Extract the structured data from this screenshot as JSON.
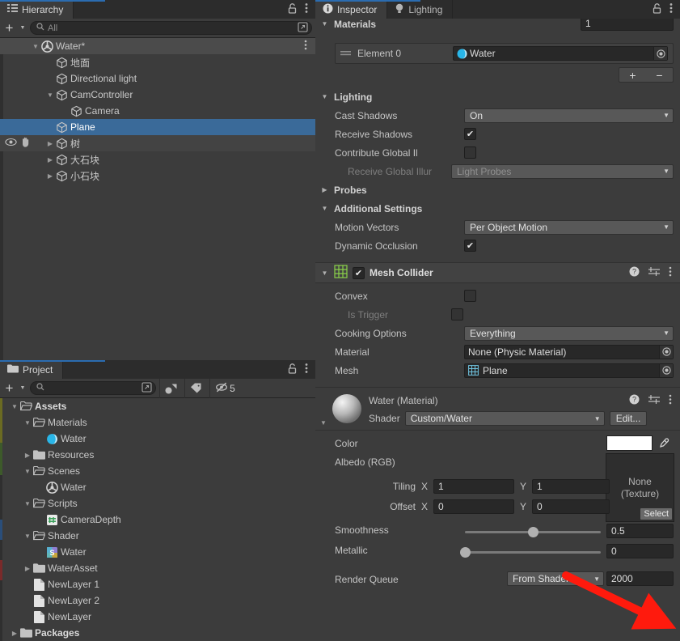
{
  "hierarchy": {
    "tab_label": "Hierarchy",
    "tab_icon": "hierarchy-icon",
    "lock_icon": "lock-icon",
    "menu_icon": "kebab-menu-icon",
    "add_label": "+",
    "search_placeholder": "All",
    "rows": [
      {
        "label": "Water*",
        "indent": 0,
        "twisty": "down",
        "icon": "unity-prefab-icon",
        "selected": false,
        "root": true,
        "menu": true
      },
      {
        "label": "地面",
        "indent": 1,
        "twisty": "none",
        "icon": "gameobject-cube-icon",
        "selected": false
      },
      {
        "label": "Directional light",
        "indent": 1,
        "twisty": "none",
        "icon": "gameobject-cube-icon",
        "selected": false
      },
      {
        "label": "CamController",
        "indent": 1,
        "twisty": "down",
        "icon": "gameobject-cube-icon",
        "selected": false
      },
      {
        "label": "Camera",
        "indent": 2,
        "twisty": "none",
        "icon": "gameobject-cube-icon",
        "selected": false
      },
      {
        "label": "Plane",
        "indent": 1,
        "twisty": "none",
        "icon": "gameobject-cube-icon",
        "selected": true
      },
      {
        "label": "树",
        "indent": 1,
        "twisty": "right",
        "icon": "gameobject-cube-icon",
        "selected": false,
        "hover": true,
        "visibility": true
      },
      {
        "label": "大石块",
        "indent": 1,
        "twisty": "right",
        "icon": "gameobject-cube-icon",
        "selected": false
      },
      {
        "label": "小石块",
        "indent": 1,
        "twisty": "right",
        "icon": "gameobject-cube-icon",
        "selected": false
      }
    ]
  },
  "project": {
    "tab_label": "Project",
    "tab_icon": "folder-icon",
    "lock_icon": "lock-icon",
    "menu_icon": "kebab-menu-icon",
    "add_label": "+",
    "search_placeholder": "",
    "filter_type_icon": "shape-filter-icon",
    "filter_label_icon": "tag-filter-icon",
    "hidden_icon": "hidden-packages-icon",
    "hidden_count": "5",
    "rows": [
      {
        "label": "Assets",
        "indent": 0,
        "twisty": "down",
        "icon": "folder-open-icon",
        "bold": true
      },
      {
        "label": "Materials",
        "indent": 1,
        "twisty": "down",
        "icon": "folder-open-icon"
      },
      {
        "label": "Water",
        "indent": 2,
        "twisty": "none",
        "icon": "material-sphere-icon"
      },
      {
        "label": "Resources",
        "indent": 1,
        "twisty": "right",
        "icon": "folder-icon"
      },
      {
        "label": "Scenes",
        "indent": 1,
        "twisty": "down",
        "icon": "folder-open-icon"
      },
      {
        "label": "Water",
        "indent": 2,
        "twisty": "none",
        "icon": "unity-scene-icon"
      },
      {
        "label": "Scripts",
        "indent": 1,
        "twisty": "down",
        "icon": "folder-open-icon"
      },
      {
        "label": "CameraDepth",
        "indent": 2,
        "twisty": "none",
        "icon": "csharp-script-icon"
      },
      {
        "label": "Shader",
        "indent": 1,
        "twisty": "down",
        "icon": "folder-open-icon"
      },
      {
        "label": "Water",
        "indent": 2,
        "twisty": "none",
        "icon": "shader-icon"
      },
      {
        "label": "WaterAsset",
        "indent": 1,
        "twisty": "right",
        "icon": "folder-icon"
      },
      {
        "label": "NewLayer 1",
        "indent": 1,
        "twisty": "none",
        "icon": "file-icon"
      },
      {
        "label": "NewLayer 2",
        "indent": 1,
        "twisty": "none",
        "icon": "file-icon"
      },
      {
        "label": "NewLayer",
        "indent": 1,
        "twisty": "none",
        "icon": "file-icon"
      },
      {
        "label": "Packages",
        "indent": 0,
        "twisty": "right",
        "icon": "folder-icon",
        "bold": true
      }
    ]
  },
  "inspector": {
    "tabs": [
      {
        "label": "Inspector",
        "icon": "info-icon",
        "active": true
      },
      {
        "label": "Lighting",
        "icon": "light-bulb-icon",
        "active": false
      }
    ],
    "lock_icon": "lock-icon",
    "menu_icon": "kebab-menu-icon",
    "materials": {
      "header": "Materials",
      "size_value": "1",
      "element_label": "Element 0",
      "element_value": "Water",
      "element_icon": "material-sphere-icon",
      "picker_icon": "object-picker-icon",
      "drag_handle_icon": "drag-handle-icon",
      "add_label": "+",
      "remove_label": "−"
    },
    "lighting": {
      "header": "Lighting",
      "rows": [
        {
          "label": "Cast Shadows",
          "kind": "dropdown",
          "value": "On"
        },
        {
          "label": "Receive Shadows",
          "kind": "checkbox",
          "checked": true
        },
        {
          "label": "Contribute Global Il",
          "kind": "checkbox",
          "checked": false
        },
        {
          "label": "Receive Global Illur",
          "kind": "dropdown",
          "value": "Light Probes",
          "disabled": true
        }
      ]
    },
    "probes": {
      "header": "Probes"
    },
    "additional_settings": {
      "header": "Additional Settings",
      "rows": [
        {
          "label": "Motion Vectors",
          "kind": "dropdown",
          "value": "Per Object Motion"
        },
        {
          "label": "Dynamic Occlusion",
          "kind": "checkbox",
          "checked": true
        }
      ]
    },
    "mesh_collider": {
      "title": "Mesh Collider",
      "icon": "mesh-collider-icon",
      "enabled": true,
      "help_icon": "help-icon",
      "preset_icon": "preset-icon",
      "menu_icon": "kebab-menu-icon",
      "rows": [
        {
          "label": "Convex",
          "kind": "checkbox",
          "checked": false
        },
        {
          "label": "Is Trigger",
          "kind": "checkbox",
          "checked": false,
          "disabled": true
        },
        {
          "label": "Cooking Options",
          "kind": "dropdown",
          "value": "Everything"
        },
        {
          "label": "Material",
          "kind": "object",
          "value": "None (Physic Material)",
          "icon": ""
        },
        {
          "label": "Mesh",
          "kind": "object",
          "value": "Plane",
          "icon": "mesh-icon"
        }
      ]
    },
    "material_preview": {
      "title": "Water (Material)",
      "preview_icon": "material-sphere-preview",
      "help_icon": "help-icon",
      "preset_icon": "preset-icon",
      "menu_icon": "kebab-menu-icon",
      "shader_label": "Shader",
      "shader_value": "Custom/Water",
      "edit_label": "Edit...",
      "expand_icon": "foldout-down-icon"
    },
    "material_props": {
      "color_label": "Color",
      "color_value_hex": "#ffffff",
      "eyedropper_icon": "eyedropper-icon",
      "albedo_label": "Albedo (RGB)",
      "texture_none_line1": "None",
      "texture_none_line2": "(Texture)",
      "select_label": "Select",
      "tiling_label": "Tiling",
      "tiling_x_label": "X",
      "tiling_x": "1",
      "tiling_y_label": "Y",
      "tiling_y": "1",
      "offset_label": "Offset",
      "offset_x_label": "X",
      "offset_x": "0",
      "offset_y_label": "Y",
      "offset_y": "0",
      "smoothness_label": "Smoothness",
      "smoothness_value": "0.5",
      "smoothness_pct": 50,
      "metallic_label": "Metallic",
      "metallic_value": "0",
      "metallic_pct": 0,
      "render_queue_label": "Render Queue",
      "render_queue_mode": "From Shader",
      "render_queue_value": "2000"
    }
  },
  "annotation": {
    "arrow_icon": "red-arrow-annotation",
    "color": "#ff1a0d"
  }
}
